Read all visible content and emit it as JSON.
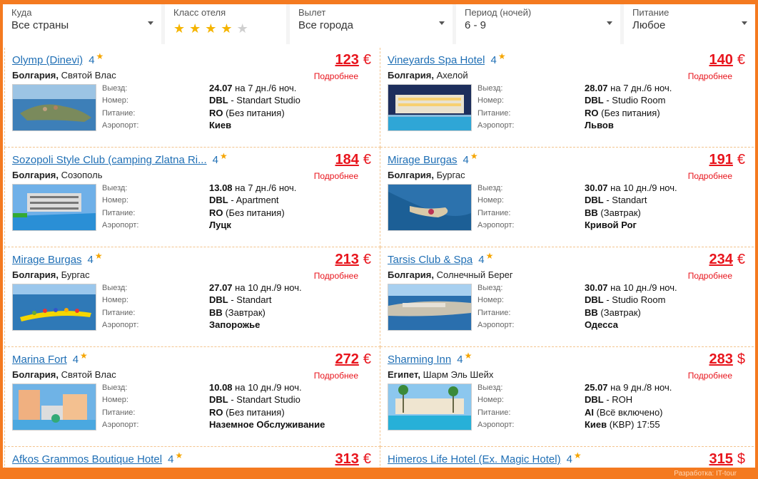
{
  "filters": {
    "destination": {
      "label": "Куда",
      "value": "Все страны"
    },
    "hotel_class": {
      "label": "Класс отеля",
      "stars_selected": 4,
      "stars_total": 5
    },
    "departure": {
      "label": "Вылет",
      "value": "Все города"
    },
    "period": {
      "label": "Период (ночей)",
      "value": "6 - 9"
    },
    "meal": {
      "label": "Питание",
      "value": "Любое"
    }
  },
  "labels": {
    "departure": "Выезд:",
    "room": "Номер:",
    "meal": "Питание:",
    "airport": "Аэропорт:",
    "more": "Подробнее"
  },
  "tours": [
    {
      "hotel": "Olymp (Dinevi)",
      "stars": "4",
      "price": "123",
      "currency": "€",
      "country": "Болгария,",
      "city": "Святой Влас",
      "date": "24.07",
      "duration": "на 7 дн./6 ноч.",
      "room_type": "DBL",
      "room": "- Standart Studio",
      "meal_code": "RO",
      "meal": "(Без питания)",
      "airport": "Киев",
      "airport_extra": "",
      "photo": "peninsula"
    },
    {
      "hotel": "Vineyards Spa Hotel",
      "stars": "4",
      "price": "140",
      "currency": "€",
      "country": "Болгария,",
      "city": "Ахелой",
      "date": "28.07",
      "duration": "на 7 дн./6 ноч.",
      "room_type": "DBL",
      "room": "- Studio Room",
      "meal_code": "RO",
      "meal": "(Без питания)",
      "airport": "Львов",
      "airport_extra": "",
      "photo": "night-hotel"
    },
    {
      "hotel": "Sozopoli Style Club (camping Zlatna Ri...",
      "stars": "4",
      "price": "184",
      "currency": "€",
      "country": "Болгария,",
      "city": "Созополь",
      "date": "13.08",
      "duration": "на 7 дн./6 ноч.",
      "room_type": "DBL",
      "room": "- Apartment",
      "meal_code": "RO",
      "meal": "(Без питания)",
      "airport": "Луцк",
      "airport_extra": "",
      "photo": "pool-hotel"
    },
    {
      "hotel": "Mirage Burgas",
      "stars": "4",
      "price": "191",
      "currency": "€",
      "country": "Болгария,",
      "city": "Бургас",
      "date": "30.07",
      "duration": "на 10 дн./9 ноч.",
      "room_type": "DBL",
      "room": "- Standart",
      "meal_code": "BB",
      "meal": "(Завтрак)",
      "airport": "Кривой Рог",
      "airport_extra": "",
      "photo": "aerial"
    },
    {
      "hotel": "Mirage Burgas",
      "stars": "4",
      "price": "213",
      "currency": "€",
      "country": "Болгария,",
      "city": "Бургас",
      "date": "27.07",
      "duration": "на 10 дн./9 ноч.",
      "room_type": "DBL",
      "room": "- Standart",
      "meal_code": "BB",
      "meal": "(Завтрак)",
      "airport": "Запорожье",
      "airport_extra": "",
      "photo": "banana-boat"
    },
    {
      "hotel": "Tarsis Club & Spa",
      "stars": "4",
      "price": "234",
      "currency": "€",
      "country": "Болгария,",
      "city": "Солнечный Берег",
      "date": "30.07",
      "duration": "на 10 дн./9 ноч.",
      "room_type": "DBL",
      "room": "- Studio Room",
      "meal_code": "BB",
      "meal": "(Завтрак)",
      "airport": "Одесса",
      "airport_extra": "",
      "photo": "coast"
    },
    {
      "hotel": "Marina Fort",
      "stars": "4",
      "price": "272",
      "currency": "€",
      "country": "Болгария,",
      "city": "Святой Влас",
      "date": "10.08",
      "duration": "на 10 дн./9 ноч.",
      "room_type": "DBL",
      "room": "- Standart Studio",
      "meal_code": "RO",
      "meal": "(Без питания)",
      "airport": "Наземное Обслуживание",
      "airport_extra": "",
      "photo": "resort"
    },
    {
      "hotel": "Sharming Inn",
      "stars": "4",
      "price": "283",
      "currency": "$",
      "country": "Египет,",
      "city": "Шарм Эль Шейх",
      "date": "25.07",
      "duration": "на 9 дн./8 ноч.",
      "room_type": "DBL",
      "room": "- ROH",
      "meal_code": "AI",
      "meal": "(Всё включено)",
      "airport": "Киев",
      "airport_extra": "(KBP) 17:55",
      "photo": "palms"
    },
    {
      "hotel": "Afkos Grammos Boutique Hotel",
      "stars": "4",
      "price": "313",
      "currency": "€"
    },
    {
      "hotel": "Himeros Life Hotel (Ex. Magic Hotel)",
      "stars": "4",
      "price": "315",
      "currency": "$"
    }
  ],
  "footer": "Разработка: IT-tour",
  "colors": {
    "accent": "#f47a20",
    "price": "#e8141c",
    "link": "#1f6fb5",
    "star": "#f5b400"
  }
}
